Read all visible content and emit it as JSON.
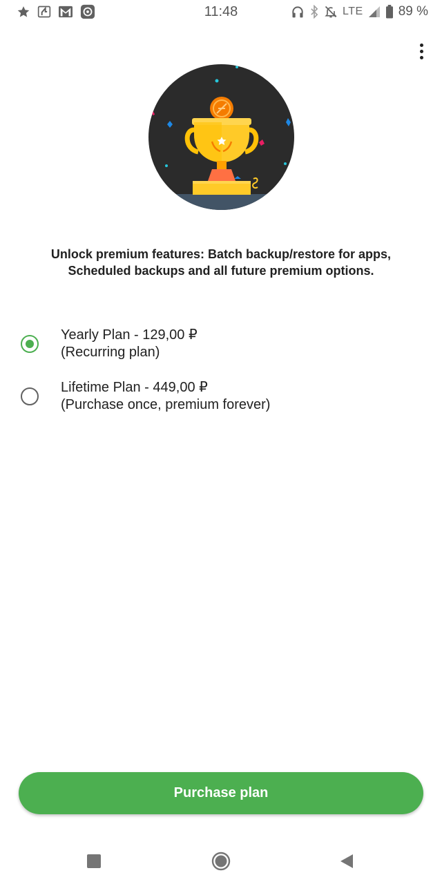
{
  "status_bar": {
    "time": "11:48",
    "network": "LTE",
    "battery": "89 %",
    "icons_left": [
      "star-icon",
      "notification-4-icon",
      "gmail-icon",
      "app-notification-icon"
    ],
    "icons_right": [
      "headphones-icon",
      "bluetooth-icon",
      "notifications-off-icon",
      "signal-icon",
      "battery-icon"
    ]
  },
  "toolbar": {
    "menu_icon": "more-vert-icon"
  },
  "hero": {
    "icon": "trophy-icon"
  },
  "description": "Unlock premium features: Batch backup/restore for apps, Scheduled backups and all future premium options.",
  "plans": [
    {
      "title": "Yearly Plan - 129,00 ₽",
      "subtitle": "(Recurring plan)",
      "selected": true
    },
    {
      "title": "Lifetime Plan - 449,00 ₽",
      "subtitle": "(Purchase once, premium forever)",
      "selected": false
    }
  ],
  "purchase_button": {
    "label": "Purchase plan"
  },
  "colors": {
    "accent": "#4caf50",
    "hero_background": "#2b2b2b"
  },
  "nav_bar": {
    "icons": [
      "recents-icon",
      "home-icon",
      "back-icon"
    ]
  }
}
